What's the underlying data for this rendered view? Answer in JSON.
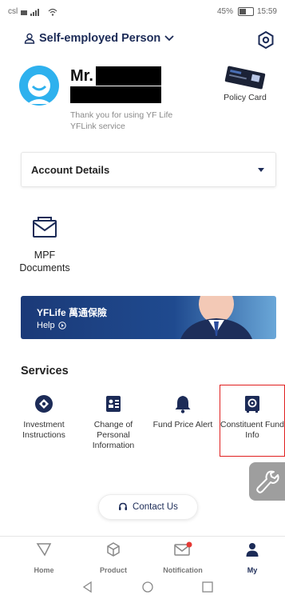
{
  "status_bar": {
    "carrier": "csl",
    "battery": "45%",
    "time": "15:59"
  },
  "header": {
    "profile_label": "Self-employed Person"
  },
  "user": {
    "name_prefix": "Mr.",
    "thanks": "Thank you for using YF Life YFLink service"
  },
  "policy_card": {
    "label": "Policy Card"
  },
  "account_details": {
    "label": "Account Details"
  },
  "mpf": {
    "label": "MPF Documents"
  },
  "banner": {
    "brand": "YFLife 萬通保險",
    "help": "Help"
  },
  "services": {
    "title": "Services",
    "items": [
      {
        "label": "Investment Instructions",
        "icon": "investment-icon"
      },
      {
        "label": "Change of Personal Information",
        "icon": "id-card-icon"
      },
      {
        "label": "Fund Price Alert",
        "icon": "bell-icon"
      },
      {
        "label": "Constituent Fund Info",
        "icon": "safe-icon"
      }
    ]
  },
  "contact": {
    "label": "Contact Us"
  },
  "bottom_nav": [
    {
      "label": "Home",
      "icon": "home-icon"
    },
    {
      "label": "Product",
      "icon": "product-icon"
    },
    {
      "label": "Notification",
      "icon": "mail-icon"
    },
    {
      "label": "My",
      "icon": "person-icon"
    }
  ],
  "colors": {
    "navy": "#1c2b57",
    "accent": "#2eb1ee",
    "highlight": "#e02020",
    "badge": "#e53935"
  }
}
